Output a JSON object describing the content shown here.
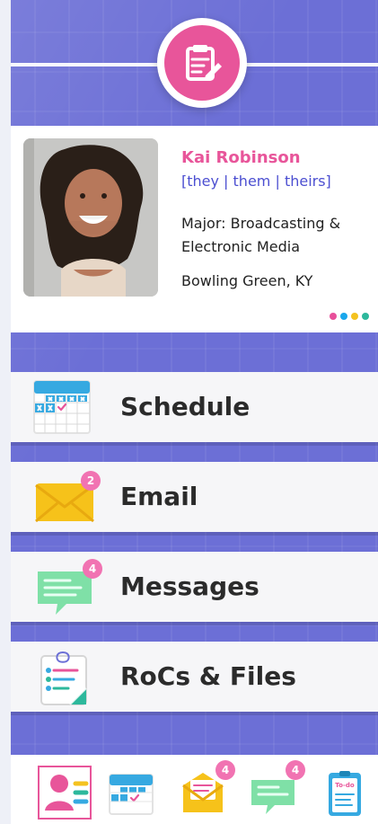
{
  "profile": {
    "name": "Kai Robinson",
    "pronouns": "[they | them | theirs]",
    "major": "Major: Broadcasting & Electronic Media",
    "location": "Bowling Green, KY"
  },
  "menu": [
    {
      "label": "Schedule",
      "icon": "calendar-icon"
    },
    {
      "label": "Email",
      "icon": "envelope-icon",
      "badge": "2"
    },
    {
      "label": "Messages",
      "icon": "message-bubble-icon",
      "badge": "4"
    },
    {
      "label": "RoCs & Files",
      "icon": "clipboard-icon"
    }
  ],
  "bottom_nav": [
    {
      "name": "profile",
      "icon": "profile-icon",
      "selected": true
    },
    {
      "name": "schedule",
      "icon": "calendar-icon"
    },
    {
      "name": "email",
      "icon": "envelope-icon",
      "badge": "4"
    },
    {
      "name": "messages",
      "icon": "message-bubble-icon",
      "badge": "4"
    },
    {
      "name": "todo",
      "icon": "todo-list-icon",
      "label": "To-do"
    }
  ],
  "colors": {
    "background": "#6c6fd6",
    "accent_pink": "#e8559a",
    "accent_blue": "#4c4fd1",
    "pagination_dots": [
      "#e84f9a",
      "#1aa7ec",
      "#f4c21f",
      "#2db89c"
    ]
  }
}
